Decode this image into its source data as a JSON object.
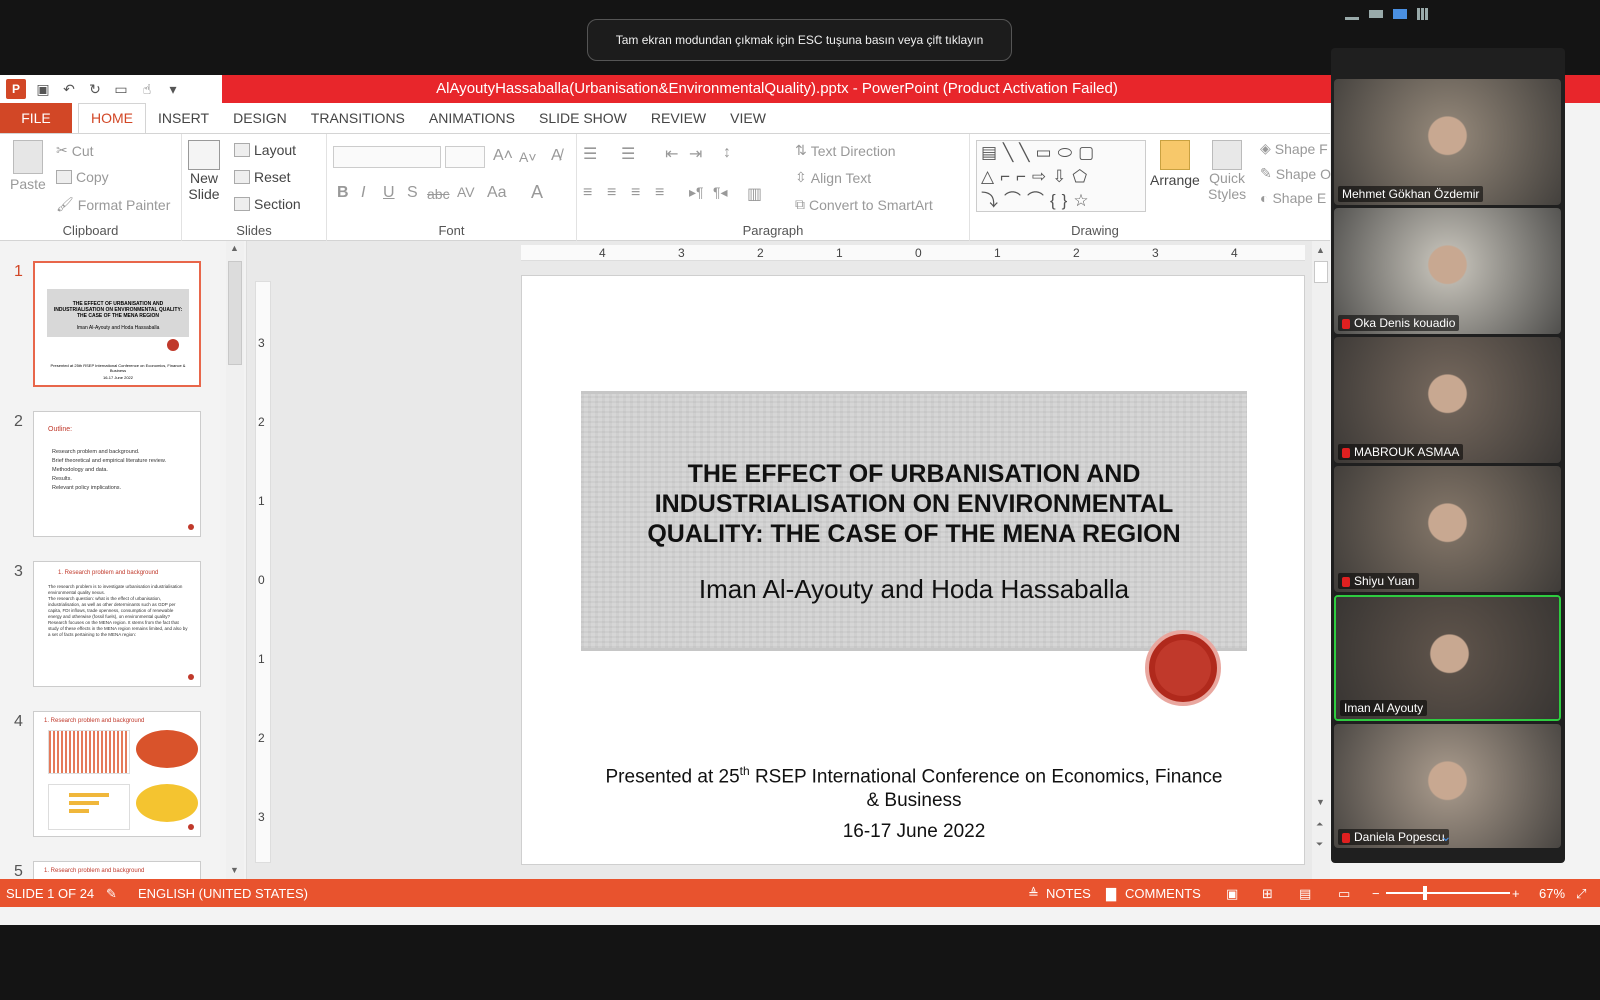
{
  "toast": {
    "text": "Tam ekran modundan çıkmak için ESC tuşuna basın veya çift tıklayın"
  },
  "window": {
    "title": "AlAyoutyHassaballa(Urbanisation&EnvironmentalQuality).pptx - PowerPoint (Product Activation Failed)"
  },
  "tabs": [
    "FILE",
    "HOME",
    "INSERT",
    "DESIGN",
    "TRANSITIONS",
    "ANIMATIONS",
    "SLIDE SHOW",
    "REVIEW",
    "VIEW"
  ],
  "ribbon": {
    "clipboard": {
      "label": "Clipboard",
      "paste": "Paste",
      "cut": "Cut",
      "copy": "Copy",
      "format_painter": "Format Painter"
    },
    "slides": {
      "label": "Slides",
      "new_slide": "New",
      "new_slide2": "Slide",
      "layout": "Layout",
      "reset": "Reset",
      "section": "Section"
    },
    "font": {
      "label": "Font"
    },
    "paragraph": {
      "label": "Paragraph",
      "text_direction": "Text Direction",
      "align_text": "Align Text",
      "convert_smartart": "Convert to SmartArt"
    },
    "drawing": {
      "label": "Drawing",
      "arrange": "Arrange",
      "quick_styles": "Quick",
      "quick_styles2": "Styles",
      "shape_fill": "Shape F",
      "shape_outline": "Shape O",
      "shape_effects": "Shape E"
    }
  },
  "thumbnails": [
    {
      "num": "1",
      "title": "THE EFFECT OF URBANISATION AND INDUSTRIALISATION ON ENVIRONMENTAL QUALITY: THE CASE OF THE MENA REGION",
      "sub": "Iman Al-Ayouty and Hoda Hassaballa",
      "foot": "Presented at 25th RSEP International Conference on Economics, Finance & Business",
      "date": "16-17 June 2022"
    },
    {
      "num": "2",
      "title": "Outline:",
      "items": [
        "Research problem and background.",
        "Brief theoretical and empirical literature review.",
        "Methodology and data.",
        "Results.",
        "Relevant policy implications."
      ]
    },
    {
      "num": "3",
      "title": "1. Research problem and background",
      "items": [
        "The research problem is to investigate urbanisation industrialisation environmental quality nexus.",
        "The research question: what is the effect of urbanisation, industrialisation, as well as other determinants such as GDP per capita, FDI inflows, trade openness, consumption of renewable energy and otherwise (fossil fuels), on environmental quality?",
        "Research focuses on the MENA region. It stems from the fact that study of these effects in the MENA region remains limited, and also by a set of facts pertaining to the MENA region:"
      ]
    },
    {
      "num": "4",
      "title": "1. Research problem and background"
    },
    {
      "num": "5",
      "title": "1. Research problem and background"
    }
  ],
  "ruler": {
    "h": [
      "4",
      "3",
      "2",
      "1",
      "0",
      "1",
      "2",
      "3",
      "4"
    ],
    "v": [
      "3",
      "2",
      "1",
      "0",
      "1",
      "2",
      "3"
    ]
  },
  "slide": {
    "title_l1": "THE EFFECT OF URBANISATION AND",
    "title_l2": "INDUSTRIALISATION ON ENVIRONMENTAL",
    "title_l3": "QUALITY: THE CASE OF THE MENA REGION",
    "authors": "Iman Al-Ayouty and Hoda Hassaballa",
    "presented_pre": "Presented at 25",
    "presented_sup": "th",
    "presented_post": " RSEP International Conference on Economics, Finance",
    "presented_l2": "& Business",
    "date": "16-17 June 2022"
  },
  "status": {
    "slide": "SLIDE 1 OF 24",
    "language": "ENGLISH (UNITED STATES)",
    "notes": "NOTES",
    "comments": "COMMENTS",
    "zoom": "67%"
  },
  "participants": [
    {
      "name": "Mehmet Gökhan Özdemir",
      "muted": false,
      "bg": "#8a7f72"
    },
    {
      "name": "Oka Denis kouadio",
      "muted": true,
      "bg": "#b9b6ae"
    },
    {
      "name": "MABROUK ASMAA",
      "muted": true,
      "bg": "#6e6258"
    },
    {
      "name": "Shiyu Yuan",
      "muted": true,
      "bg": "#7a6e62"
    },
    {
      "name": "Iman Al Ayouty",
      "muted": false,
      "bg": "#5a5048",
      "active": true
    },
    {
      "name": "Daniela Popescu",
      "muted": true,
      "bg": "#9c8f82"
    }
  ]
}
